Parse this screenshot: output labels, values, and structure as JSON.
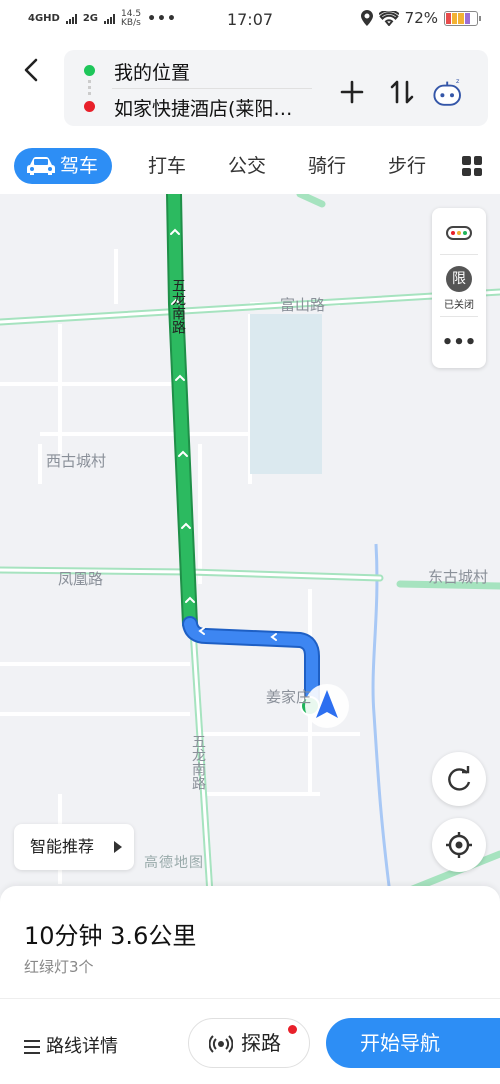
{
  "status_bar": {
    "network1": "4GHD",
    "network2": "2G",
    "speed": "14.5",
    "speed_unit": "KB/s",
    "more": "•••",
    "time": "17:07",
    "battery": "72%"
  },
  "route": {
    "origin": "我的位置",
    "destination": "如家快捷酒店(莱阳…"
  },
  "tabs": [
    "驾车",
    "打车",
    "公交",
    "骑行",
    "步行"
  ],
  "map": {
    "roads": {
      "wulong_top": "五龙南路",
      "fushan": "富山路",
      "fenghuang": "凤凰路",
      "wulong_bottom": "五龙南路"
    },
    "places": {
      "xigucheng": "西古城村",
      "donggucheng": "东古城村",
      "jiangjia": "姜家庄"
    },
    "restriction_icon_label": "限",
    "restriction_status": "已关闭",
    "more": "•••",
    "smart_recommend": "智能推荐",
    "provider_logo": "高德地图"
  },
  "summary": {
    "eta": "10分钟  3.6公里",
    "lights": "红绿灯3个"
  },
  "actions": {
    "route_detail": "路线详情",
    "explore": "探路",
    "start": "开始导航"
  },
  "colors": {
    "accent": "#2d8ef5",
    "route_green": "#1fb45a",
    "route_blue": "#2b7cf0"
  }
}
